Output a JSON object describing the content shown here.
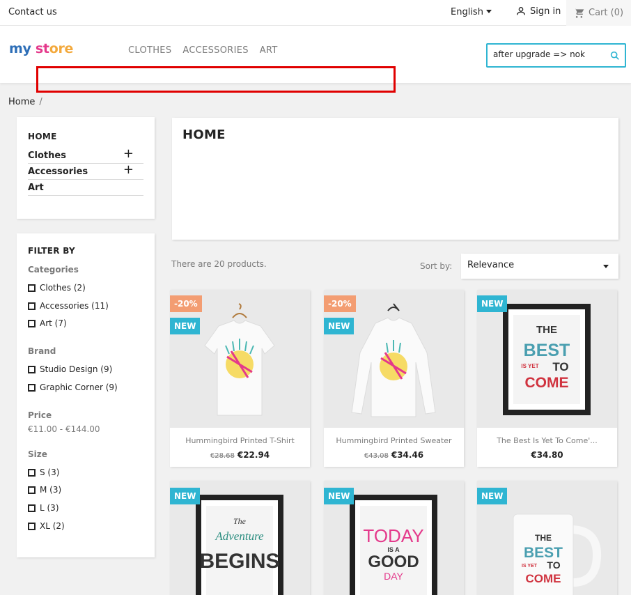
{
  "topbar": {
    "contact": "Contact us",
    "language": "English",
    "signin": "Sign in",
    "cart": "Cart (0)"
  },
  "header": {
    "logo": {
      "part1": "my",
      "part2": "st",
      "part3": "ore"
    },
    "menu": [
      "CLOTHES",
      "ACCESSORIES",
      "ART"
    ],
    "search_value": "after upgrade => nok"
  },
  "breadcrumb": {
    "home": "Home",
    "sep": "/"
  },
  "categories": {
    "title": "HOME",
    "items": [
      {
        "label": "Clothes",
        "expand": "+"
      },
      {
        "label": "Accessories",
        "expand": "+"
      },
      {
        "label": "Art"
      }
    ]
  },
  "filters": {
    "title": "FILTER BY",
    "categories_title": "Categories",
    "categories": [
      "Clothes (2)",
      "Accessories (11)",
      "Art (7)"
    ],
    "brand_title": "Brand",
    "brands": [
      "Studio Design (9)",
      "Graphic Corner (9)"
    ],
    "price_title": "Price",
    "price_range": "€11.00 - €144.00",
    "size_title": "Size",
    "sizes": [
      "S (3)",
      "M (3)",
      "L (3)",
      "XL (2)"
    ]
  },
  "main": {
    "heading": "HOME",
    "count": "There are 20 products.",
    "sort_label": "Sort by:",
    "sort_value": "Relevance"
  },
  "products": [
    {
      "name": "Hummingbird Printed T-Shirt",
      "old_price": "€28.68",
      "price": "€22.94",
      "discount": "-20%",
      "new": "NEW"
    },
    {
      "name": "Hummingbird Printed Sweater",
      "old_price": "€43.08",
      "price": "€34.46",
      "discount": "-20%",
      "new": "NEW"
    },
    {
      "name": "The Best Is Yet To Come'...",
      "price": "€34.80",
      "new": "NEW"
    },
    {
      "new": "NEW"
    },
    {
      "new": "NEW"
    },
    {
      "new": "NEW"
    }
  ],
  "artwork_text": {
    "best": [
      "THE",
      "BEST",
      "IS YET",
      "TO",
      "COME"
    ],
    "adventure": [
      "The",
      "Adventure",
      "BEGINS"
    ],
    "today": [
      "TODAY",
      "IS A",
      "GOOD",
      "DAY"
    ]
  },
  "colors": {
    "accent": "#2fb5d2",
    "discount": "#f39d72",
    "highlight_box": "#e00000"
  }
}
